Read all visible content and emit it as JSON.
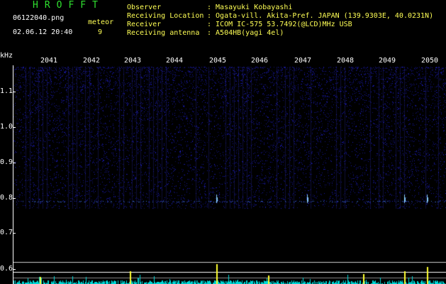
{
  "header": {
    "brand": "HROFFT",
    "filename": "06122040.png",
    "datetime": "02.06.12 20:40",
    "meteor_label": "meteor",
    "meteor_count": "9",
    "observer_label": "Observer",
    "observer_value": ": Masayuki Kobayashi",
    "location_label": "Receiving Location",
    "location_value": ": Ogata-vill. Akita-Pref. JAPAN (139.9303E, 40.0231N)",
    "receiver_label": "Receiver",
    "receiver_value": ": ICOM IC-575 53.7492(@LCD)MHz USB",
    "antenna_label": "Receiving antenna",
    "antenna_value": ": A504HB(yagi 4el)"
  },
  "axes": {
    "y_unit": "kHz",
    "y_ticks": [
      "1.1",
      "1.0",
      "0.9",
      "0.8",
      "0.7",
      "0.6"
    ],
    "x_ticks": [
      "2041",
      "2042",
      "2043",
      "2044",
      "2045",
      "2046",
      "2047",
      "2048",
      "2049",
      "2050"
    ]
  },
  "colors": {
    "background": "#000000",
    "brand": "#2fe02f",
    "header_text": "#ffff55",
    "noise": "#1a1aa0",
    "signal": "#00d8d8",
    "meteor": "#ffff30"
  }
}
